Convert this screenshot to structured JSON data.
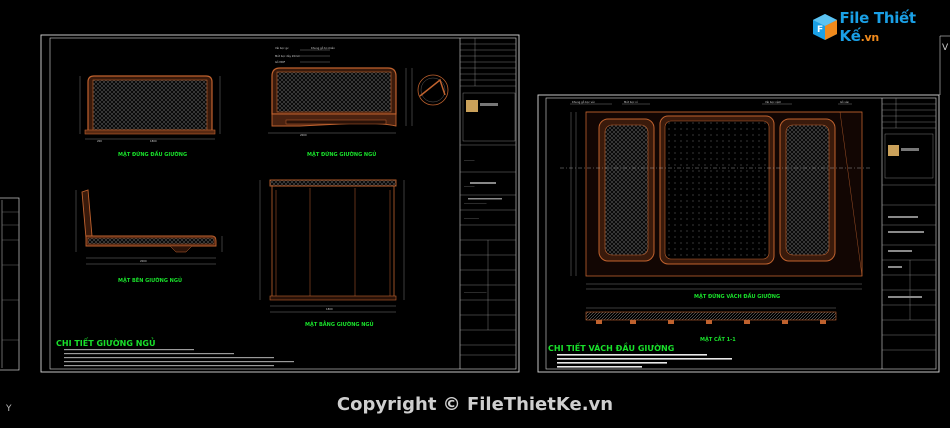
{
  "watermark": {
    "logo_text": "File Thiết Kế",
    "logo_suffix": ".vn",
    "copyright": "Copyright © FileThietKe.vn"
  },
  "sheet1": {
    "views": {
      "front_headboard": "MẶT ĐỨNG ĐẦU GIƯỜNG",
      "side_bed": "MẶT ĐỨNG GIƯỜNG NGỦ",
      "side_view": "MẶT BÊN GIƯỜNG NGỦ",
      "plan_view": "MẶT BẰNG GIƯỜNG NGỦ"
    },
    "title": "CHI TIẾT GIƯỜNG NGỦ"
  },
  "sheet2": {
    "views": {
      "wall_elevation": "MẶT ĐỨNG VÁCH ĐẦU GIƯỜNG",
      "section": "MẶT CẮT 1-1"
    },
    "title": "CHI TIẾT VÁCH ĐẦU GIƯỜNG"
  },
  "colors": {
    "background": "#000000",
    "frame": "#d9d9d9",
    "bed_outline": "#c0622e",
    "label_green": "#19e02b",
    "logo_blue": "#1aa0e6",
    "logo_orange": "#f08a1c"
  },
  "axis_label": "Y",
  "icons": [
    "logo-cube-icon"
  ]
}
